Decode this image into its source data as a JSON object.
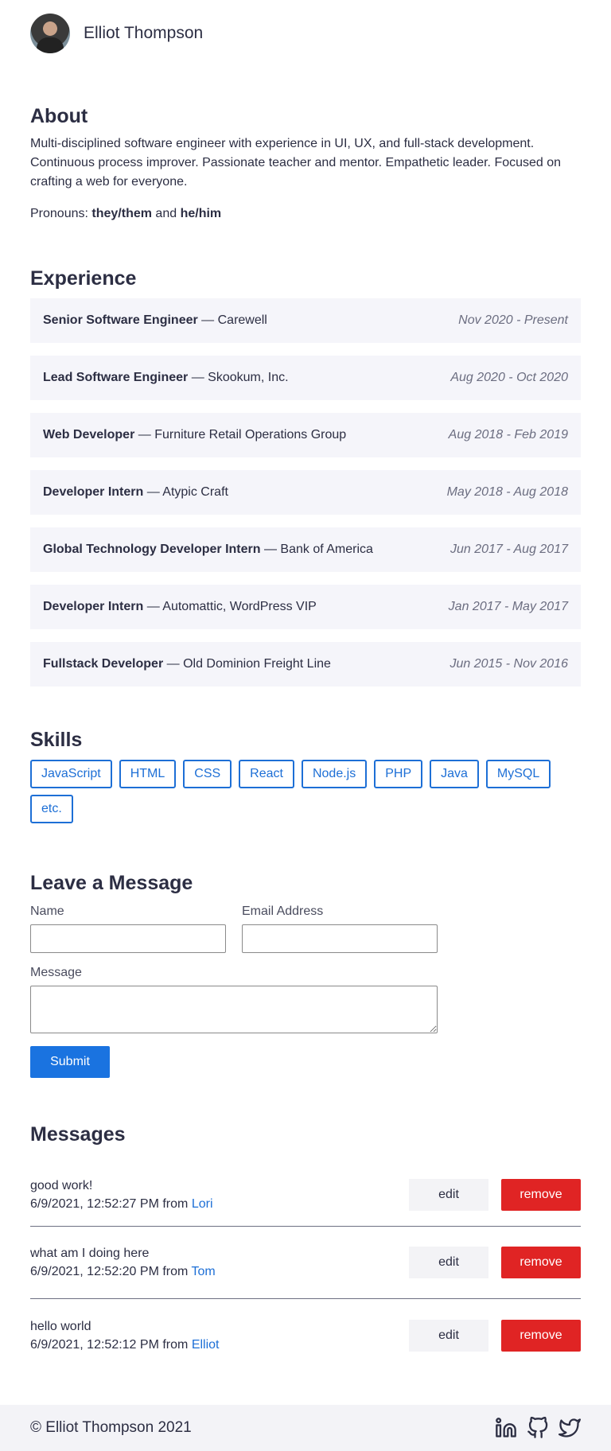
{
  "header": {
    "name": "Elliot Thompson"
  },
  "about": {
    "title": "About",
    "bio": "Multi-disciplined software engineer with experience in UI, UX, and full-stack development. Continuous process improver. Passionate teacher and mentor. Empathetic leader. Focused on crafting a web for everyone.",
    "pronouns_label": "Pronouns:",
    "pronoun_1": "they/them",
    "pronoun_join": "and",
    "pronoun_2": "he/him"
  },
  "experience": {
    "title": "Experience",
    "items": [
      {
        "role": "Senior Software Engineer",
        "company": "Carewell",
        "dates": "Nov 2020 - Present"
      },
      {
        "role": "Lead Software Engineer",
        "company": "Skookum, Inc.",
        "dates": "Aug 2020 - Oct 2020"
      },
      {
        "role": "Web Developer",
        "company": "Furniture Retail Operations Group",
        "dates": "Aug 2018 - Feb 2019"
      },
      {
        "role": "Developer Intern",
        "company": "Atypic Craft",
        "dates": "May 2018 - Aug 2018"
      },
      {
        "role": "Global Technology Developer Intern",
        "company": "Bank of America",
        "dates": "Jun 2017 - Aug 2017"
      },
      {
        "role": "Developer Intern",
        "company": "Automattic, WordPress VIP",
        "dates": "Jan 2017 - May 2017"
      },
      {
        "role": "Fullstack Developer",
        "company": "Old Dominion Freight Line",
        "dates": "Jun 2015 - Nov 2016"
      }
    ]
  },
  "skills": {
    "title": "Skills",
    "items": [
      "JavaScript",
      "HTML",
      "CSS",
      "React",
      "Node.js",
      "PHP",
      "Java",
      "MySQL",
      "etc."
    ]
  },
  "form": {
    "title": "Leave a Message",
    "name_label": "Name",
    "email_label": "Email Address",
    "message_label": "Message",
    "name_value": "",
    "email_value": "",
    "message_value": "",
    "submit_label": "Submit"
  },
  "messages": {
    "title": "Messages",
    "from_label": "from",
    "edit_label": "edit",
    "remove_label": "remove",
    "items": [
      {
        "text": "good work!",
        "timestamp": "6/9/2021, 12:52:27 PM",
        "author": "Lori"
      },
      {
        "text": "what am I doing here",
        "timestamp": "6/9/2021, 12:52:20 PM",
        "author": "Tom"
      },
      {
        "text": "hello world",
        "timestamp": "6/9/2021, 12:52:12 PM",
        "author": "Elliot"
      }
    ]
  },
  "footer": {
    "copyright": "© Elliot Thompson 2021",
    "social": [
      "linkedin-icon",
      "github-icon",
      "twitter-icon"
    ]
  },
  "colors": {
    "accent": "#1d6fd6",
    "submit": "#1a73e0",
    "danger": "#e02424",
    "card_bg": "#f5f5fa"
  }
}
